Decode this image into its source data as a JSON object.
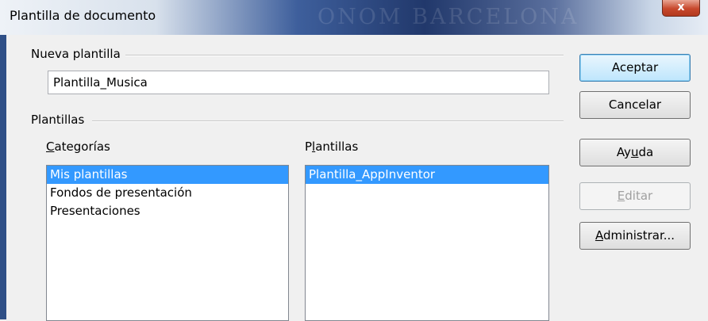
{
  "window": {
    "title": "Plantilla de documento",
    "background_text": "ONOM BARCELONA",
    "close_glyph": "x"
  },
  "new_template": {
    "group_label": "Nueva plantilla",
    "value": "Plantilla_Musica"
  },
  "templates": {
    "group_label": "Plantillas",
    "categories": {
      "label_pre": "",
      "label_mnemonic": "C",
      "label_post": "ategorías",
      "items": [
        {
          "label": "Mis plantillas",
          "selected": true
        },
        {
          "label": "Fondos de presentación",
          "selected": false
        },
        {
          "label": "Presentaciones",
          "selected": false
        }
      ]
    },
    "templates_list": {
      "label_pre": "P",
      "label_mnemonic": "l",
      "label_post": "antillas",
      "items": [
        {
          "label": "Plantilla_AppInventor",
          "selected": true
        }
      ]
    }
  },
  "buttons": {
    "ok": "Aceptar",
    "cancel": "Cancelar",
    "help_pre": "Ay",
    "help_mnemonic": "u",
    "help_post": "da",
    "edit_pre": "",
    "edit_mnemonic": "E",
    "edit_post": "ditar",
    "manage_pre": "",
    "manage_mnemonic": "A",
    "manage_post": "dministrar..."
  },
  "colors": {
    "selection": "#3399ff",
    "dialog_bg": "#f0f0f0"
  }
}
